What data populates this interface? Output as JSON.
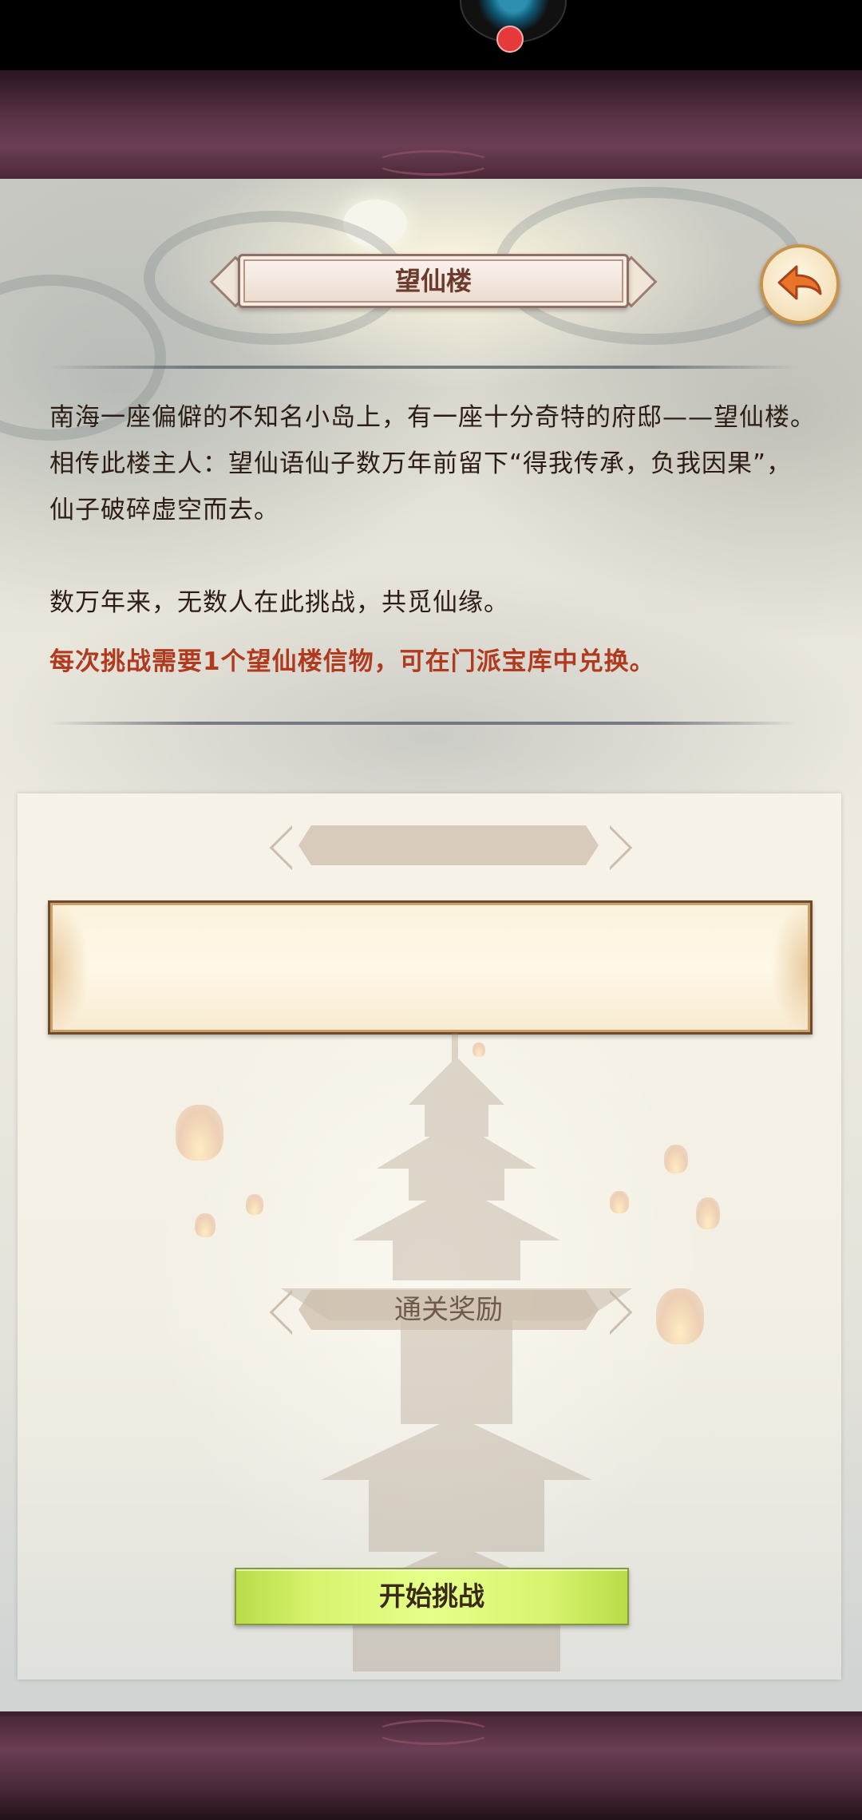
{
  "title": "望仙楼",
  "description": {
    "paragraph1": "南海一座偏僻的不知名小岛上，有一座十分奇特的府邸——望仙楼。相传此楼主人：望仙语仙子数万年前留下“得我传承，负我因果”，仙子破碎虚空而去。",
    "paragraph2": "数万年来，无数人在此挑战，共觅仙缘。",
    "note": "每次挑战需要1个望仙楼信物，可在门派宝库中兑换。"
  },
  "card": {
    "top_ribbon_label": "",
    "rewards_label": "通关奖励"
  },
  "buttons": {
    "start_label": "开始挑战"
  },
  "colors": {
    "note": "#b13a1e",
    "start_button": "#d8f36e",
    "frame": "#5a3347"
  },
  "icons": {
    "back": "back-arrow-icon"
  }
}
